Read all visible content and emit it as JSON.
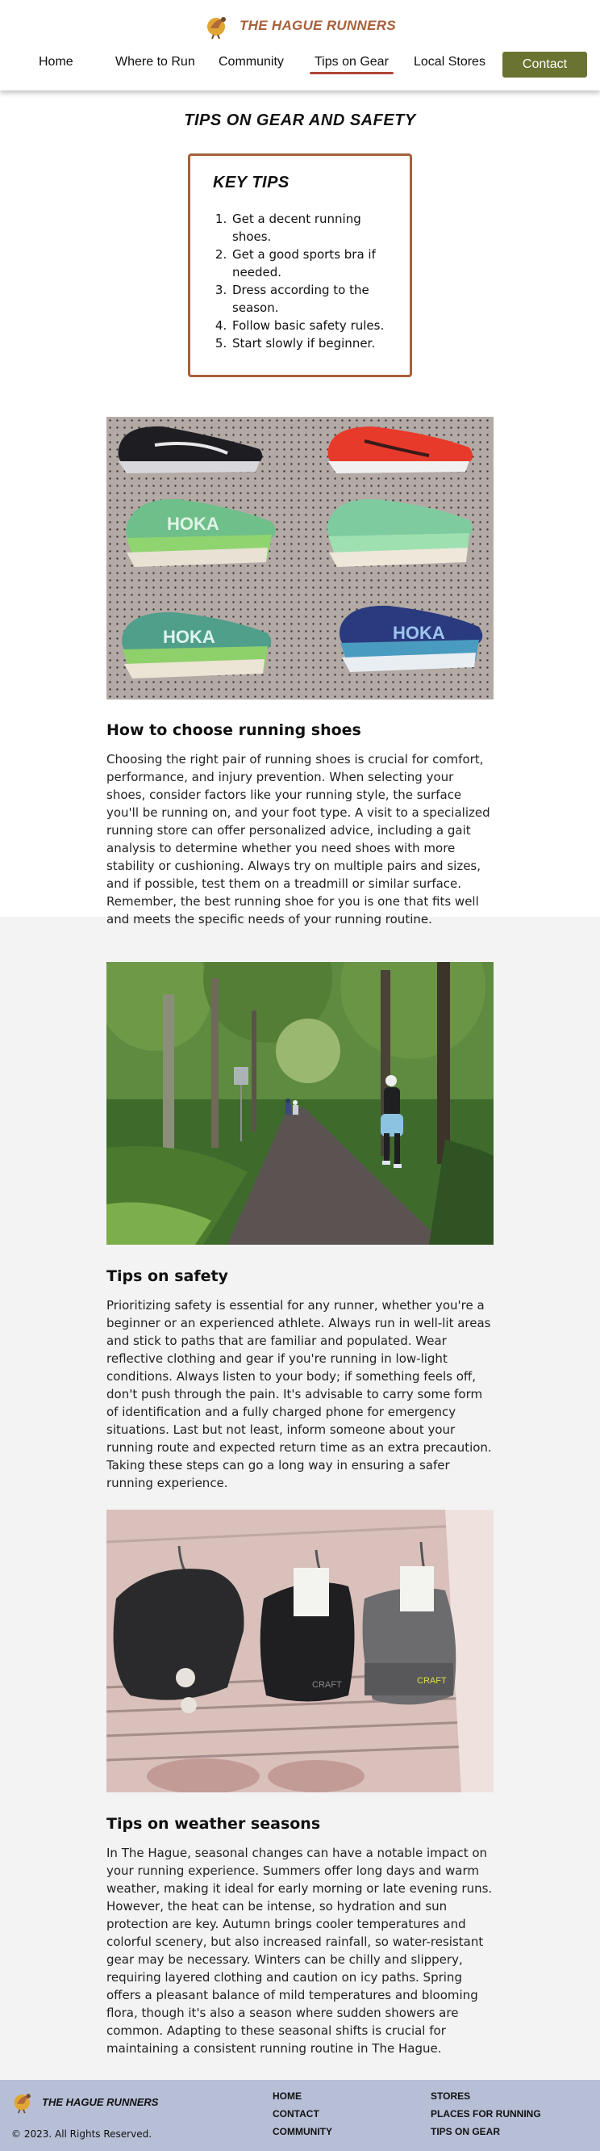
{
  "brand": {
    "name": "THE HAGUE RUNNERS",
    "logo_icon": "runner-bird-logo"
  },
  "nav": {
    "items": [
      "Home",
      "Where to Run",
      "Community",
      "Tips on Gear",
      "Local Stores"
    ],
    "active": "Tips on Gear",
    "contact_label": "Contact"
  },
  "colors": {
    "brand": "#a8603a",
    "contact_button": "#6b7330",
    "active_underline": "#b0453a",
    "footer": "#b7bfd7",
    "band": "#f3f3f3"
  },
  "page": {
    "title": "TIPS ON GEAR AND SAFETY"
  },
  "key_tips": {
    "title": "KEY TIPS",
    "items": [
      "Get a decent running shoes.",
      "Get a good sports bra if needed.",
      "Dress according to the season.",
      "Follow basic safety rules.",
      "Start slowly if beginner."
    ]
  },
  "sections": [
    {
      "title": "How to choose running shoes",
      "image": "running-shoes-display-photo",
      "text": "Choosing the right pair of running shoes is crucial for comfort, performance, and injury prevention. When selecting your shoes, consider factors like your running style, the surface you'll be running on, and your foot type. A visit to a specialized running store can offer personalized advice, including a gait analysis to determine whether you need shoes with more stability or cushioning. Always try on multiple pairs and sizes, and if possible, test them on a treadmill or similar surface. Remember, the best running shoe for you is one that fits well and meets the specific needs of your running routine."
    },
    {
      "title": "Tips on safety",
      "image": "forest-path-runner-photo",
      "text": "Prioritizing safety is essential for any runner, whether you're a beginner or an experienced athlete. Always run in well-lit areas and stick to paths that are familiar and populated. Wear reflective clothing and gear if you're running in low-light conditions. Always listen to your body; if something feels off, don't push through the pain. It's advisable to carry some form of identification and a fully charged phone for emergency situations. Last but not least, inform someone about your running route and expected return time as an extra precaution. Taking these steps can go a long way in ensuring a safer running experience."
    },
    {
      "title": "Tips on weather seasons",
      "image": "running-beanies-photo",
      "text": "In The Hague, seasonal changes can have a notable impact on your running experience. Summers offer long days and warm weather, making it ideal for early morning or late evening runs. However, the heat can be intense, so hydration and sun protection are key. Autumn brings cooler temperatures and colorful scenery, but also increased rainfall, so water-resistant gear may be necessary. Winters can be chilly and slippery, requiring layered clothing and caution on icy paths. Spring offers a pleasant balance of mild temperatures and blooming flora, though it's also a season where sudden showers are common. Adapting to these seasonal shifts is crucial for maintaining a consistent running routine in The Hague."
    }
  ],
  "footer": {
    "brand": "THE HAGUE RUNNERS",
    "copyright": "© 2023. All Rights Reserved.",
    "links_col1": [
      "HOME",
      "CONTACT",
      "COMMUNITY"
    ],
    "links_col2": [
      "STORES",
      "PLACES FOR RUNNING",
      "TIPS ON GEAR"
    ]
  }
}
